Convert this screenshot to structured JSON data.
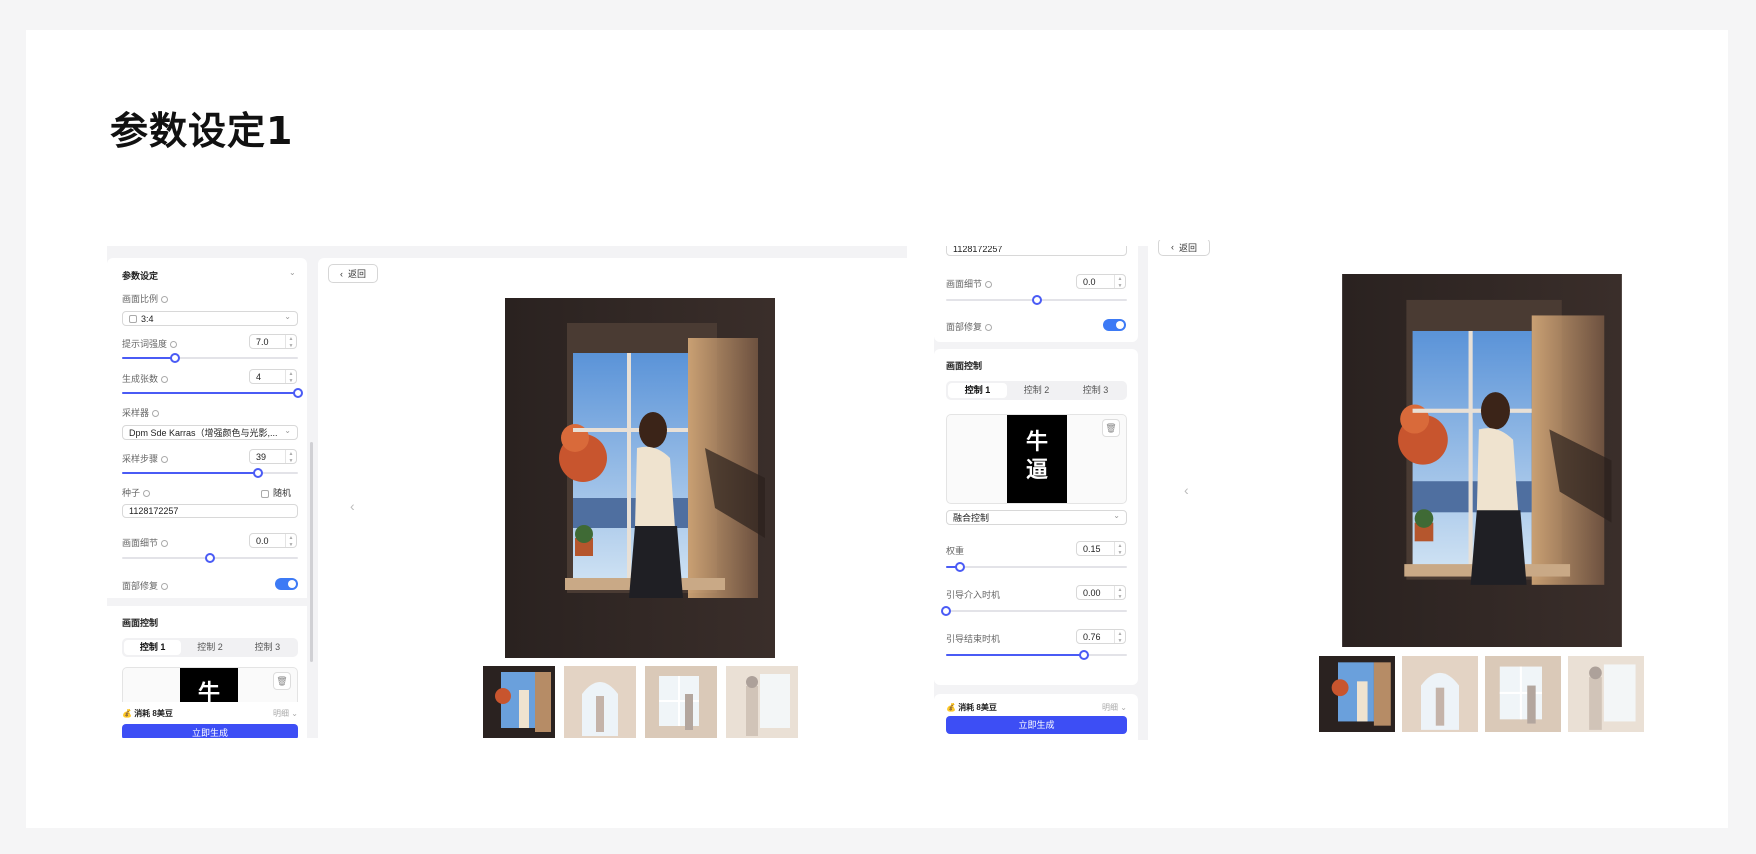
{
  "page": {
    "title": "参数设定1"
  },
  "colors": {
    "accent": "#4a5bf5",
    "generate": "#3d4ef5",
    "toggle": "#3d7af5"
  },
  "left_panel": {
    "header": "参数设定",
    "ratio_label": "画面比例",
    "ratio_value": "3:4",
    "prompt_strength_label": "提示词强度",
    "prompt_strength_value": "7.0",
    "prompt_strength_fraction": 0.3,
    "count_label": "生成张数",
    "count_value": "4",
    "count_fraction": 1.0,
    "sampler_label": "采样器",
    "sampler_value": "Dpm Sde Karras（增强颜色与光影,...",
    "steps_label": "采样步骤",
    "steps_value": "39",
    "steps_fraction": 0.77,
    "seed_label": "种子",
    "random_label": "随机",
    "seed_value": "1128172257",
    "detail_label": "画面细节",
    "detail_value": "0.0",
    "detail_fraction": 0.5,
    "face_label": "面部修复",
    "control_header": "画面控制",
    "tabs": [
      "控制 1",
      "控制 2",
      "控制 3"
    ],
    "ctrl_image_text": "牛",
    "cost": "消耗 8美豆",
    "detail_link": "明细",
    "generate": "立即生成"
  },
  "left_preview": {
    "back": "返回",
    "prev_icon": "chevron-left-icon"
  },
  "right_panel": {
    "seed_value": "1128172257",
    "detail_label": "画面细节",
    "detail_value": "0.0",
    "detail_fraction": 0.5,
    "face_label": "面部修复",
    "control_header": "画面控制",
    "tabs": [
      "控制 1",
      "控制 2",
      "控制 3"
    ],
    "ctrl_image_text_1": "牛",
    "ctrl_image_text_2": "逼",
    "mode_value": "融合控制",
    "weight_label": "权重",
    "weight_value": "0.15",
    "weight_fraction": 0.08,
    "start_label": "引导介入时机",
    "start_value": "0.00",
    "start_fraction": 0.0,
    "end_label": "引导结束时机",
    "end_value": "0.76",
    "end_fraction": 0.76,
    "cost": "消耗 8美豆",
    "detail_link": "明细",
    "generate": "立即生成"
  },
  "right_preview": {
    "back": "返回"
  }
}
